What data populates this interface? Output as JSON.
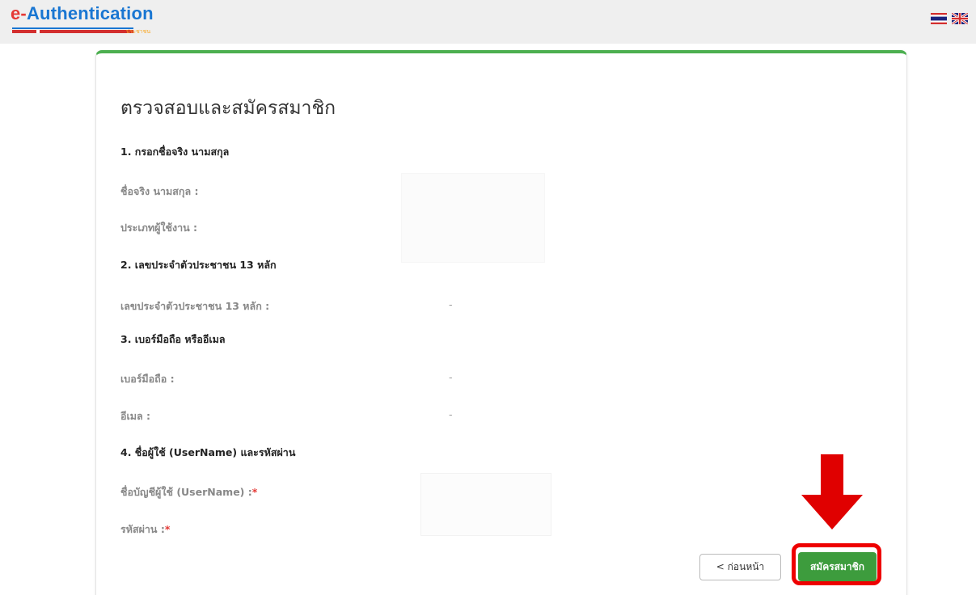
{
  "header": {
    "logo_prefix": "e-",
    "logo_main": "Authentication",
    "logo_sub": "ประชาชน",
    "lang_thai": "TH",
    "lang_english": "EN"
  },
  "form": {
    "title": "ตรวจสอบและสมัครสมาชิก",
    "sections": [
      {
        "heading": "1. กรอกชื่อจริง นามสกุล"
      },
      {
        "heading": "2. เลขประจำตัวประชาชน 13 หลัก"
      },
      {
        "heading": "3. เบอร์มือถือ หรืออีเมล"
      },
      {
        "heading": "4. ชื่อผู้ใช้ (UserName) และรหัสผ่าน"
      }
    ],
    "fields": {
      "full_name_label": "ชื่อจริง นามสกุล :",
      "user_type_label": "ประเภทผู้ใช้งาน :",
      "id_label": "เลขประจำตัวประชาชน 13 หลัก :",
      "id_value": "-",
      "mobile_label": "เบอร์มือถือ :",
      "mobile_value": "-",
      "email_label": "อีเมล :",
      "email_value": "-",
      "username_label": "ชื่อบัญชีผู้ใช้ (UserName) :",
      "password_label": "รหัสผ่าน :",
      "required_mark": "*"
    },
    "buttons": {
      "back": "< ก่อนหน้า",
      "submit": "สมัครสมาชิก"
    }
  },
  "annotation": {
    "highlight_color": "#e00000",
    "arrow_color": "#e00000"
  },
  "colors": {
    "accent_green": "#4caf50",
    "button_green": "#3d9c3d",
    "logo_blue": "#1976d2",
    "logo_red": "#e53935"
  }
}
